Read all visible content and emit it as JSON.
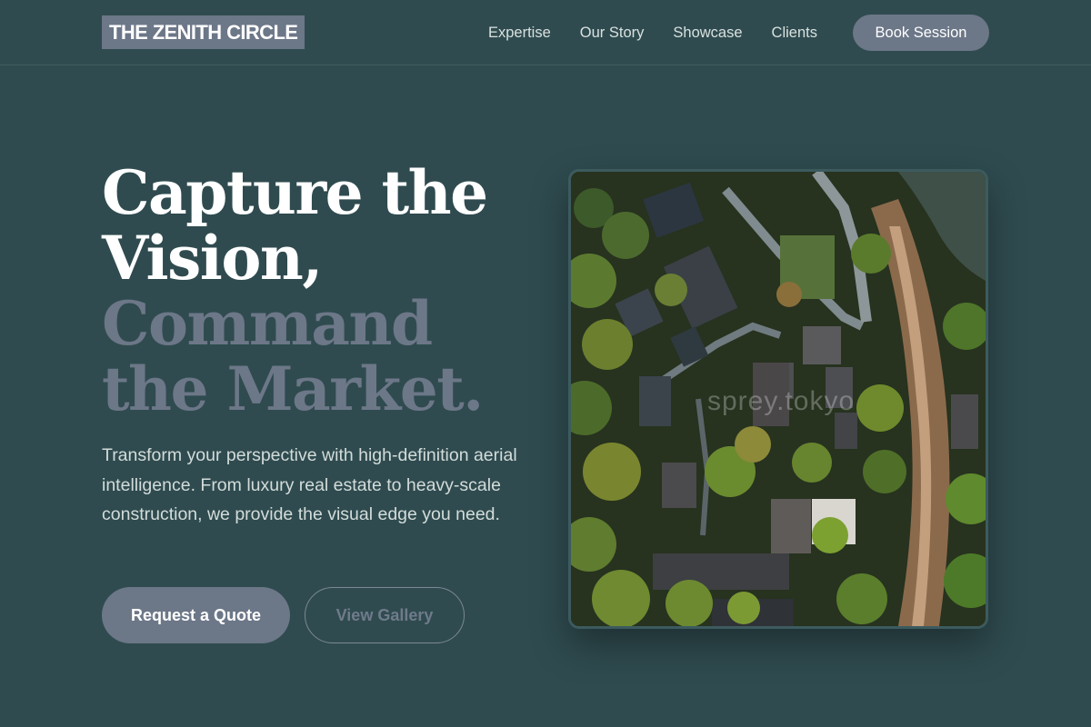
{
  "brand": {
    "name": "THE ZENITH CIRCLE"
  },
  "nav": {
    "links": [
      "Expertise",
      "Our Story",
      "Showcase",
      "Clients"
    ],
    "cta": "Book Session"
  },
  "hero": {
    "title_line_1": "Capture the",
    "title_line_2": "Vision,",
    "title_line_3": "Command",
    "title_line_4": "the Market.",
    "description": "Transform your perspective with high-definition aerial intelligence. From luxury real estate to heavy-scale construction, we provide the visual edge you need.",
    "primary_button": "Request a Quote",
    "secondary_button": "View Gallery",
    "image": {
      "alt_icon": "aerial-photo",
      "watermark": "sprey.tokyo"
    }
  },
  "colors": {
    "background": "#2f4b4f",
    "accent": "#6c7788",
    "text": "#ffffff"
  }
}
